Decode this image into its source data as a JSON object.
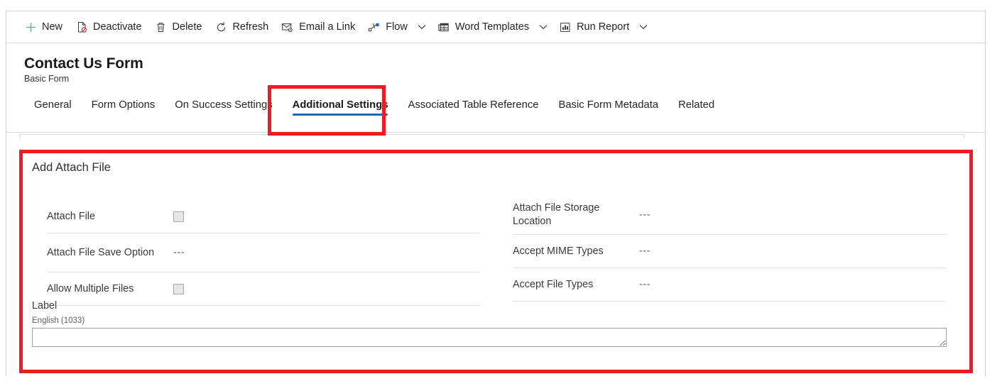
{
  "colors": {
    "accent": "#0f6cbd",
    "annotation": "#ed1c24",
    "new_icon": "#5ec08a",
    "deactivate_icon": "#d13438",
    "text": "#242424"
  },
  "command_bar": {
    "buttons": [
      {
        "label": "New",
        "icon": "plus-icon",
        "caret": false
      },
      {
        "label": "Deactivate",
        "icon": "deactivate-icon",
        "caret": false
      },
      {
        "label": "Delete",
        "icon": "trash-icon",
        "caret": false
      },
      {
        "label": "Refresh",
        "icon": "refresh-icon",
        "caret": false
      },
      {
        "label": "Email a Link",
        "icon": "email-link-icon",
        "caret": false
      },
      {
        "label": "Flow",
        "icon": "flow-icon",
        "caret": true
      },
      {
        "label": "Word Templates",
        "icon": "word-template-icon",
        "caret": true
      },
      {
        "label": "Run Report",
        "icon": "run-report-icon",
        "caret": true
      }
    ]
  },
  "header": {
    "title": "Contact Us Form",
    "subtitle": "Basic Form"
  },
  "tabs": {
    "items": [
      {
        "label": "General",
        "selected": false
      },
      {
        "label": "Form Options",
        "selected": false
      },
      {
        "label": "On Success Settings",
        "selected": false
      },
      {
        "label": "Additional Settings",
        "selected": true
      },
      {
        "label": "Associated Table Reference",
        "selected": false
      },
      {
        "label": "Basic Form Metadata",
        "selected": false
      },
      {
        "label": "Related",
        "selected": false
      }
    ]
  },
  "section": {
    "title": "Add Attach File",
    "left_fields": [
      {
        "label": "Attach File",
        "type": "checkbox",
        "checked": false,
        "value": ""
      },
      {
        "label": "Attach File Save Option",
        "type": "text",
        "value": "---"
      },
      {
        "label": "Allow Multiple Files",
        "type": "checkbox",
        "checked": false,
        "value": ""
      }
    ],
    "right_fields": [
      {
        "label": "Attach File Storage Location",
        "type": "text",
        "value": "---"
      },
      {
        "label": "Accept MIME Types",
        "type": "text",
        "value": "---"
      },
      {
        "label": "Accept File Types",
        "type": "text",
        "value": "---"
      }
    ],
    "label_block": {
      "title": "Label",
      "language": "English (1033)",
      "value": "",
      "placeholder": ""
    }
  },
  "annotations": [
    {
      "name": "additional-settings-highlight"
    },
    {
      "name": "add-attach-file-section-highlight"
    }
  ]
}
